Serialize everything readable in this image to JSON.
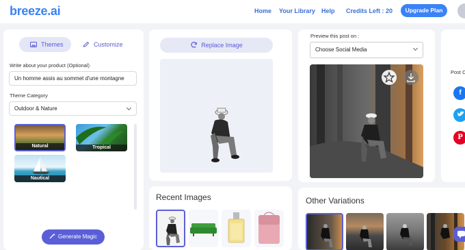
{
  "header": {
    "logo": "breeze.ai",
    "nav": [
      "Home",
      "Your Library",
      "Help"
    ],
    "credits": "Credits Left : 20",
    "upgrade": "Upgrade Plan"
  },
  "left_panel": {
    "tabs": [
      "Themes",
      "Customize"
    ],
    "product_label": "Write about your product (Optional)",
    "product_value": "Un homme assis au sommet d'une montagne",
    "category_label": "Theme Category",
    "category_value": "Outdoor & Nature",
    "themes": [
      "Natural",
      "Tropical",
      "Nautical"
    ],
    "generate": "Generate Magic"
  },
  "center_panel": {
    "replace": "Replace Image"
  },
  "recent": {
    "title": "Recent Images"
  },
  "preview": {
    "label": "Preview this post on :",
    "social_select": "Choose Social Media"
  },
  "share": {
    "label": "Post On"
  },
  "variations": {
    "title": "Other Variations"
  },
  "colors": {
    "accent": "#3b82f6",
    "purple": "#5a5fd8",
    "facebook": "#1877f2",
    "twitter": "#1da1f2",
    "pinterest": "#e60023"
  }
}
